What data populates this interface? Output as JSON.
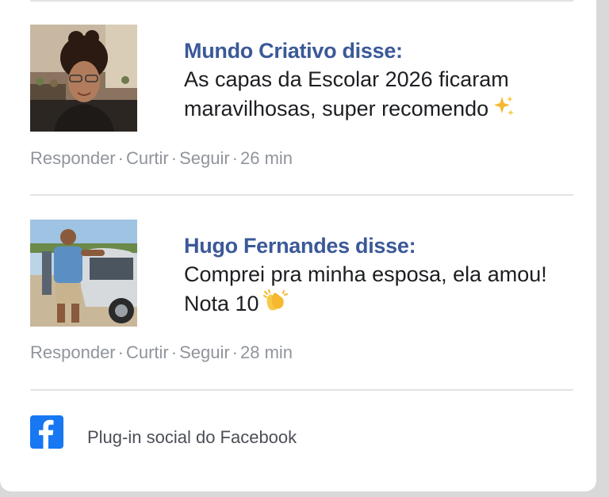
{
  "comments": [
    {
      "author": "Mundo Criativo disse:",
      "text": "As capas da Escolar 2026 ficaram maravilhosas, super recomendo",
      "emoji": "sparkles-icon",
      "actions": {
        "reply": "Responder",
        "like": "Curtir",
        "follow": "Seguir",
        "time": "26 min"
      }
    },
    {
      "author": "Hugo Fernandes disse:",
      "text_line1": "Comprei pra minha esposa, ela amou!",
      "text_line2": "Nota 10",
      "emoji": "clapping-hands-icon",
      "actions": {
        "reply": "Responder",
        "like": "Curtir",
        "follow": "Seguir",
        "time": "28 min"
      }
    }
  ],
  "footer": {
    "plugin_label": "Plug-in social do Facebook",
    "icon": "facebook-icon",
    "brand_color": "#1877f2"
  },
  "separator": "·"
}
